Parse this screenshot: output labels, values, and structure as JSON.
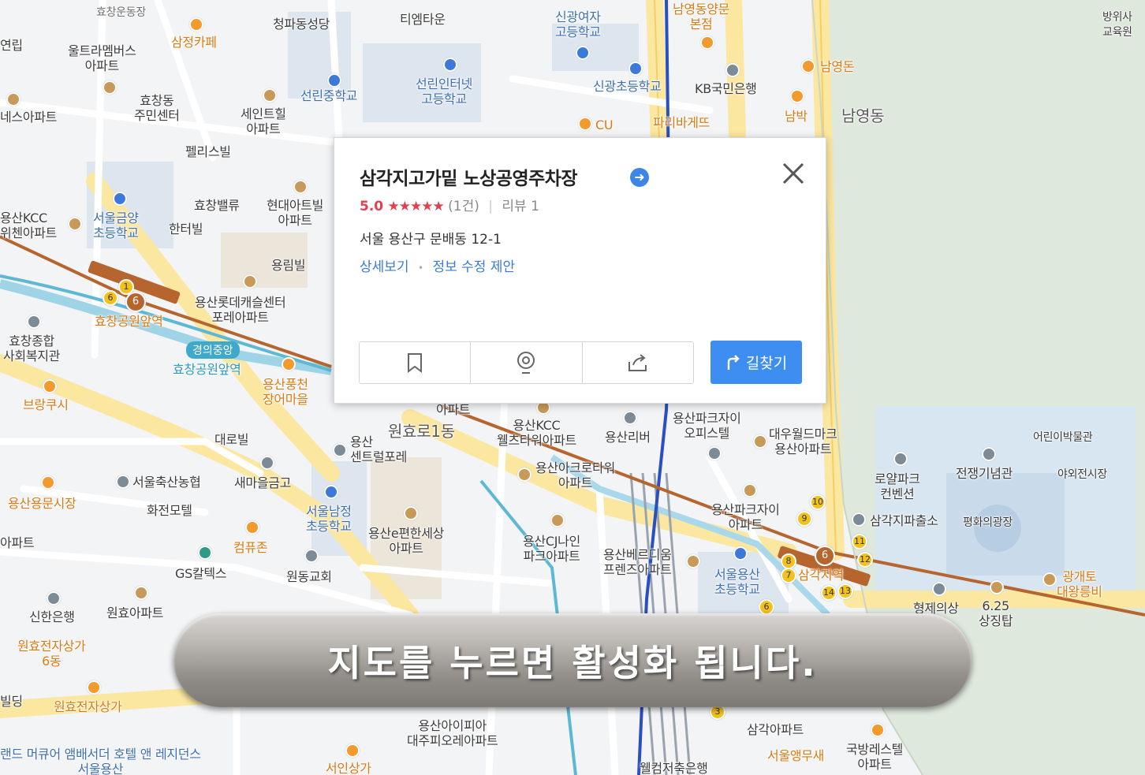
{
  "map": {
    "labels": {
      "hyochang_stadium": "효창운동장",
      "cheongpa_church": "청파동성당",
      "tm_town": "티엠타운",
      "singwang_girls_high": "신광여자\n고등학교",
      "namyoung_main": "남영동양문\n본점",
      "bangwisa": "방위사\n교육원",
      "yeonrip": "연립",
      "ultra_members": "울트라멤버스\n아파트",
      "samjeong_cafe": "삼정카페",
      "seollin_middle": "선린중학교",
      "seollin_internet_high": "선린인터넷\n고등학교",
      "singwang_elem": "신광초등학교",
      "kb_bank": "KB국민은행",
      "namyoungdon": "남영돈",
      "hyochang_office": "효창동\n주민센터",
      "saint_hill": "세인트힐\n아파트",
      "nese_apt": "네스아파트",
      "cu": "CU",
      "paris_baguette": "파리바게뜨",
      "nambak": "남박",
      "namyoung_dong": "남영동",
      "felis_bill": "펠리스빌",
      "hyochang_valley": "효창밸류",
      "hyundai_apt": "현대아트빌\n아파트",
      "yongsan_kcc": "용산KCC\n위첸아파트",
      "seoul_geumyang": "서울금양\n초등학교",
      "hanter_bill": "한터빌",
      "yongrim_bill": "용림빌",
      "lotte_castle": "용산롯데캐슬센터\n포레아파트",
      "hyochang_park_station": "효창공원앞역",
      "gyeongui_line": "경의중앙",
      "hyochang_park_station2": "효창공원앞역",
      "hyochang_welfare": "효창종합\n사회복지관",
      "yongsan_pungcheon": "용산풍천\n장어마을",
      "brake": "브랑쿠시",
      "daero_bill": "대로빌",
      "yongsan_central": "용산\n센트럴포레",
      "wonhyo_1dong": "원효로1동",
      "kcc_wellstower": "용산KCC\n웰츠타워아파트",
      "yongsan_river": "용산리버",
      "park_xi_office": "용산파크자이\n오피스텔",
      "daewoo_world": "대우월드마크\n용산아파트",
      "childrens_museum": "어린이박물관",
      "seoul_livestock": "서울축산농협",
      "saemaeul": "새마을금고",
      "acro_tower": "용산아크로타워\n아파트",
      "royal_park": "로얄파크\n컨벤션",
      "war_memorial": "전쟁기념관",
      "outdoor_exhibit": "야외전시장",
      "yongsan_market": "용산용문시장",
      "hwajeon_motel": "화전모텔",
      "seoul_namjeong": "서울남정\n초등학교",
      "e_pyeonhan": "용산e편한세상\n아파트",
      "cj_ninepark": "용산CJ나인\n파크아파트",
      "park_xi_apt": "용산파크자이\n아파트",
      "samgakji_police": "삼각지파출소",
      "peace_plaza": "평화의광장",
      "compzone": "컴퓨존",
      "gs_caltex": "GS칼텍스",
      "wondong_church": "원동교회",
      "yongsan_berdium": "용산베르디움\n프렌즈아파트",
      "seoul_yongsan_elem": "서울용산\n초등학교",
      "samgakji_station": "삼각지역",
      "gwanggaeto": "광개토\n대왕릉비",
      "shinhan_bank": "신한은행",
      "wonhyo_apt": "원효아파트",
      "hyeongje": "형제의상",
      "sangjingtap": "6.25\n상징탑",
      "wonhyo_elec_6": "원효전자상가\n6동",
      "wonhyo_elec": "원효전자상가",
      "bilding": "빌딩",
      "land_mercure": "랜드 머큐어 앰배서더 호텔 앤 레지던스\n서울용산",
      "yongsan_ipark": "용산아이피아\n대주피오레아파트",
      "samgak_apt": "삼각아파트",
      "seoul_angmusae": "서울앵무새",
      "defense_restel": "국방레스텔\n아파트",
      "welcome_bank": "웰컴저축은행",
      "seoin_sangga": "서인상가",
      "apart": "아파트",
      "apt_left": "아파트"
    }
  },
  "popup": {
    "title": "삼각지고가밑 노상공영주차장",
    "score": "5.0",
    "stars": "★★★★★",
    "review_count": "(1건)",
    "review_label": "리뷰 1",
    "address": "서울 용산구 문배동 12-1",
    "detail_link": "상세보기",
    "edit_link": "정보 수정 제안",
    "route_label": "길찾기"
  },
  "banner": {
    "text": "지도를 누르면 활성화 됩니다."
  },
  "colors": {
    "accent_blue": "#3d8ef0",
    "rating_red": "#e0404f",
    "line6_brown": "#b5652d",
    "line1_blue": "#2a4fbf",
    "gyeongui_teal": "#3fa9c9"
  }
}
